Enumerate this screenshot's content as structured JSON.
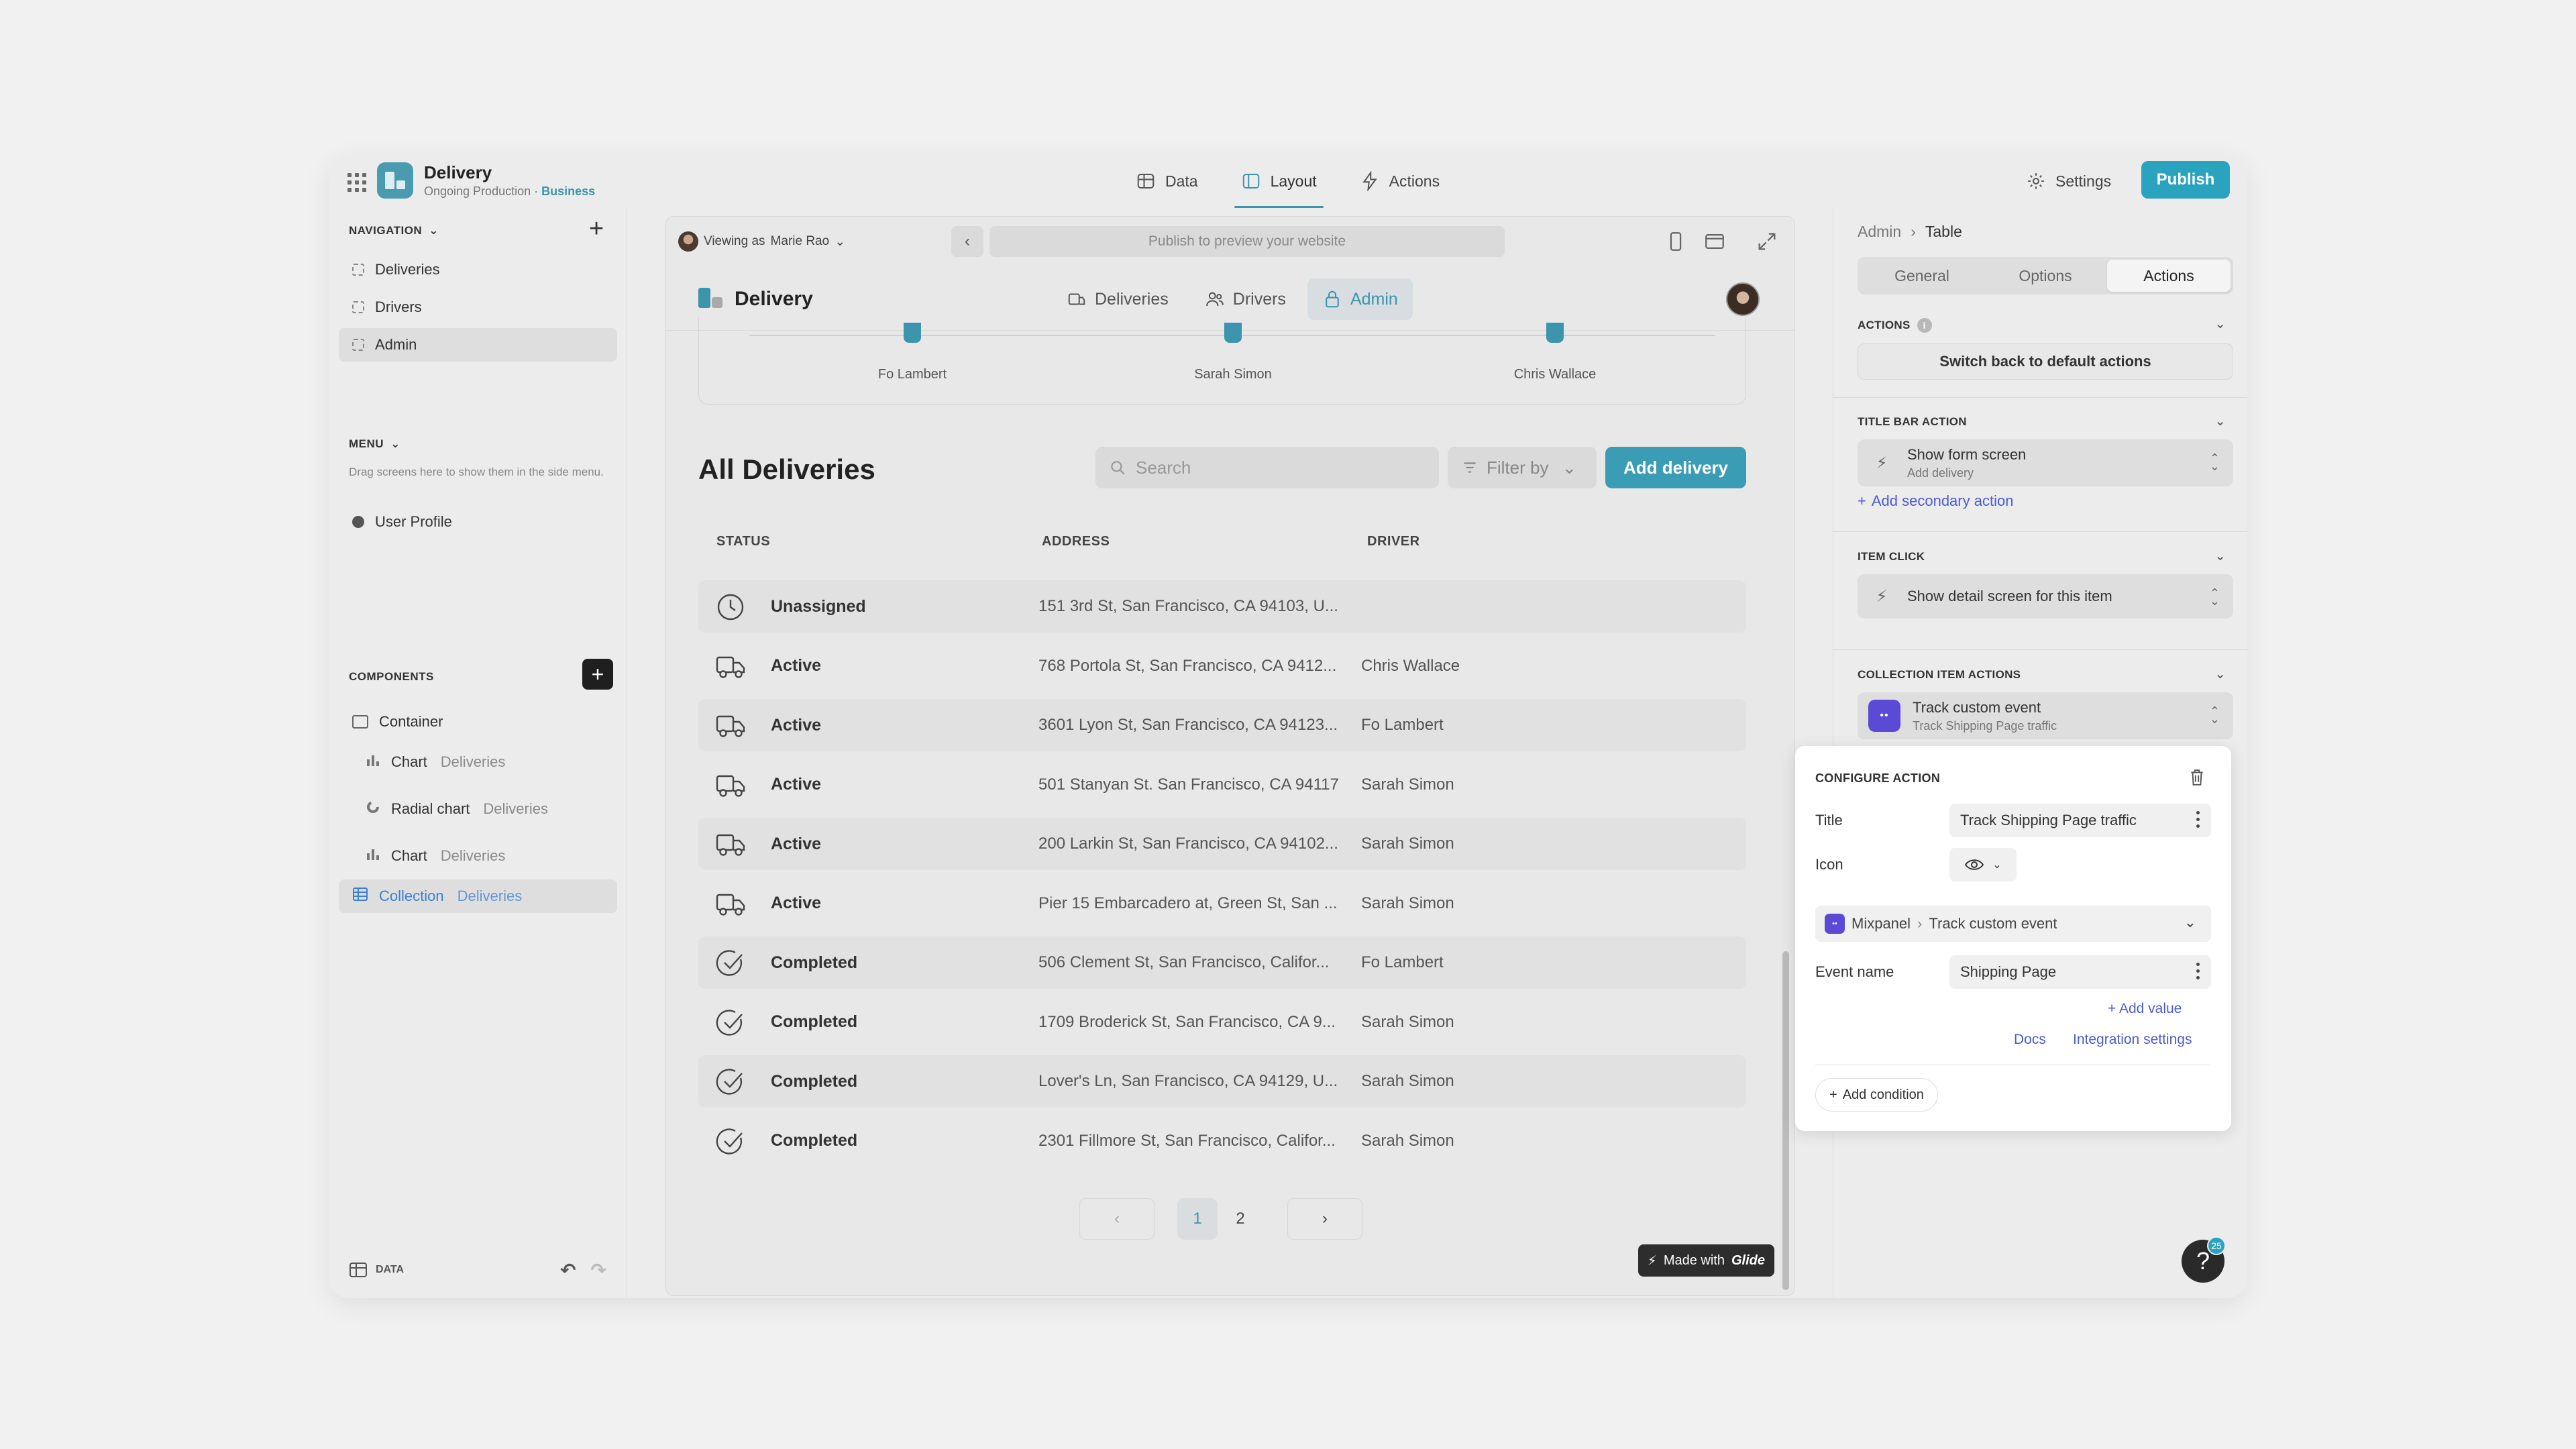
{
  "app": {
    "name": "Delivery",
    "subtitle": "Ongoing Production · ",
    "plan": "Business"
  },
  "topnav": {
    "tabs": [
      {
        "label": "Data"
      },
      {
        "label": "Layout"
      },
      {
        "label": "Actions"
      }
    ],
    "active_tab": "Layout",
    "settings_label": "Settings",
    "publish_label": "Publish"
  },
  "sidebar": {
    "navigation_label": "NAVIGATION",
    "nav_items": [
      {
        "label": "Deliveries"
      },
      {
        "label": "Drivers"
      },
      {
        "label": "Admin"
      }
    ],
    "menu_label": "MENU",
    "menu_hint": "Drag screens here to show them in the side menu.",
    "menu_items": [
      {
        "label": "User Profile"
      }
    ],
    "components_label": "COMPONENTS",
    "components": [
      {
        "label": "Container",
        "source": ""
      },
      {
        "label": "Chart",
        "source": "Deliveries"
      },
      {
        "label": "Radial chart",
        "source": "Deliveries"
      },
      {
        "label": "Chart",
        "source": "Deliveries"
      },
      {
        "label": "Collection",
        "source": "Deliveries"
      }
    ],
    "footer_data_label": "DATA"
  },
  "preview": {
    "viewing_prefix": "Viewing as",
    "viewing_user": "Marie Rao",
    "url_placeholder": "Publish to preview your website",
    "app_title": "Delivery",
    "tabs": [
      {
        "label": "Deliveries"
      },
      {
        "label": "Drivers"
      },
      {
        "label": "Admin"
      }
    ],
    "active_tab": "Admin",
    "chart_labels": [
      "Fo Lambert",
      "Sarah Simon",
      "Chris Wallace"
    ],
    "list_title": "All Deliveries",
    "search_placeholder": "Search",
    "filter_label": "Filter by",
    "add_button": "Add delivery",
    "columns": {
      "status": "STATUS",
      "address": "ADDRESS",
      "driver": "DRIVER"
    },
    "rows": [
      {
        "status": "Unassigned",
        "address": "151 3rd St, San Francisco, CA 94103, U...",
        "driver": "",
        "icon": "clock-icon"
      },
      {
        "status": "Active",
        "address": "768 Portola St, San Francisco, CA 9412...",
        "driver": "Chris Wallace",
        "icon": "truck-icon"
      },
      {
        "status": "Active",
        "address": "3601 Lyon St, San Francisco, CA 94123...",
        "driver": "Fo Lambert",
        "icon": "truck-icon"
      },
      {
        "status": "Active",
        "address": "501 Stanyan St. San Francisco, CA 94117",
        "driver": "Sarah Simon",
        "icon": "truck-icon"
      },
      {
        "status": "Active",
        "address": "200 Larkin St, San Francisco, CA 94102...",
        "driver": "Sarah Simon",
        "icon": "truck-icon"
      },
      {
        "status": "Active",
        "address": "Pier 15 Embarcadero at, Green St, San ...",
        "driver": "Sarah Simon",
        "icon": "truck-icon"
      },
      {
        "status": "Completed",
        "address": "506 Clement St, San Francisco, Califor...",
        "driver": "Fo Lambert",
        "icon": "check-circle-icon"
      },
      {
        "status": "Completed",
        "address": "1709 Broderick St, San Francisco, CA 9...",
        "driver": "Sarah Simon",
        "icon": "check-circle-icon"
      },
      {
        "status": "Completed",
        "address": "Lover's Ln, San Francisco, CA 94129, U...",
        "driver": "Sarah Simon",
        "icon": "check-circle-icon"
      },
      {
        "status": "Completed",
        "address": "2301 Fillmore St, San Francisco, Califor...",
        "driver": "Sarah Simon",
        "icon": "check-circle-icon"
      }
    ],
    "pages": [
      "1",
      "2"
    ],
    "current_page": "1",
    "made_with": "Made with",
    "made_with_brand": "Glide"
  },
  "panel": {
    "breadcrumb": [
      "Admin",
      "Table"
    ],
    "tabs": [
      {
        "label": "General"
      },
      {
        "label": "Options"
      },
      {
        "label": "Actions"
      }
    ],
    "active_tab": "Actions",
    "actions_label": "ACTIONS",
    "switch_back": "Switch back to default actions",
    "title_bar_label": "TITLE BAR ACTION",
    "title_bar_action": {
      "title": "Show form screen",
      "subtitle": "Add delivery"
    },
    "add_secondary": "Add secondary action",
    "item_click_label": "ITEM CLICK",
    "item_click_action": "Show detail screen for this item",
    "collection_actions_label": "COLLECTION ITEM ACTIONS",
    "collection_action": {
      "title": "Track custom event",
      "subtitle": "Track Shipping Page traffic"
    },
    "configure": {
      "header": "CONFIGURE ACTION",
      "title_label": "Title",
      "title_value": "Track Shipping Page traffic",
      "icon_label": "Icon",
      "integration": "Mixpanel",
      "integration_action": "Track custom event",
      "event_label": "Event name",
      "event_value": "Shipping Page",
      "add_value": "Add value",
      "docs": "Docs",
      "integration_settings": "Integration settings",
      "add_condition": "Add condition"
    },
    "help_badge": "25"
  },
  "colors": {
    "accent": "#2aa3bf",
    "link": "#4b5bd6",
    "mixpanel": "#5a4ad6"
  }
}
